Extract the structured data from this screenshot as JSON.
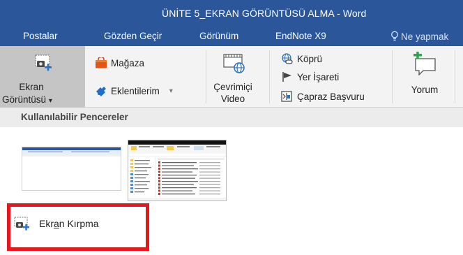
{
  "window": {
    "title": "ÜNİTE 5_EKRAN GÖRÜNTÜSÜ ALMA - Word"
  },
  "tabs": [
    {
      "label": "Postalar"
    },
    {
      "label": "Gözden Geçir"
    },
    {
      "label": "Görünüm"
    },
    {
      "label": "EndNote X9"
    }
  ],
  "tell_me": {
    "placeholder": "Ne yapmak"
  },
  "ribbon": {
    "screenshot": {
      "line1": "Ekran",
      "line2": "Görüntüsü",
      "arrow": "▾"
    },
    "store": {
      "label": "Mağaza"
    },
    "addins": {
      "label": "Eklentilerim",
      "arrow": "▾"
    },
    "online_video": {
      "line1": "Çevrimiçi",
      "line2": "Video"
    },
    "link": {
      "label": "Köprü"
    },
    "bookmark": {
      "label": "Yer İşareti"
    },
    "cross_ref": {
      "label": "Çapraz Başvuru"
    },
    "comment": {
      "label": "Yorum"
    }
  },
  "dropdown": {
    "header": "Kullanılabilir Pencereler",
    "crop": {
      "label_pre": "Ekr",
      "label_u": "a",
      "label_post": "n Kırpma"
    }
  },
  "colors": {
    "accent": "#2b579a",
    "highlight": "#e8151c"
  }
}
